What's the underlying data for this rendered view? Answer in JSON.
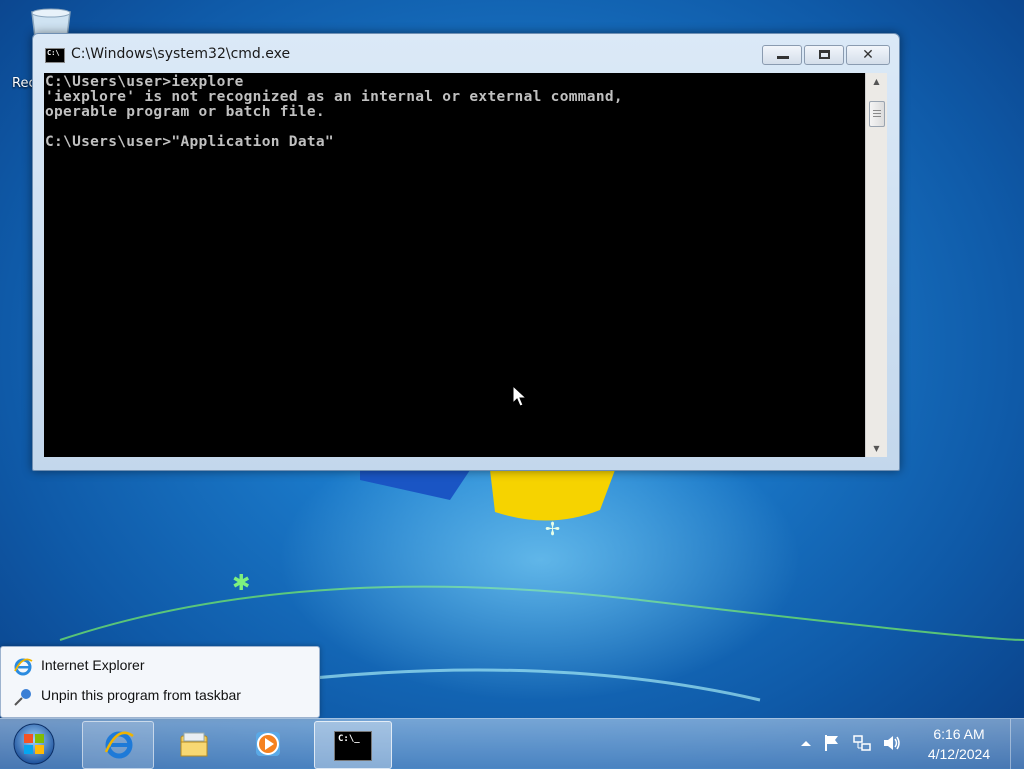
{
  "desktop": {
    "recycle_bin_label": "Recycle Bin"
  },
  "cmd_window": {
    "title": "C:\\Windows\\system32\\cmd.exe",
    "icon_text": "C:\\",
    "console_lines": [
      "C:\\Users\\user>iexplore",
      "'iexplore' is not recognized as an internal or external command,",
      "operable program or batch file.",
      "",
      "C:\\Users\\user>\"Application Data\""
    ]
  },
  "jumplist": {
    "items": [
      {
        "label": "Internet Explorer",
        "icon": "internet-explorer-icon"
      },
      {
        "label": "Unpin this program from taskbar",
        "icon": "unpin-icon"
      }
    ]
  },
  "taskbar": {
    "buttons": [
      {
        "name": "internet-explorer",
        "icon": "internet-explorer-icon"
      },
      {
        "name": "windows-explorer",
        "icon": "folder-icon"
      },
      {
        "name": "media-player",
        "icon": "media-player-icon"
      },
      {
        "name": "command-prompt",
        "icon": "cmd-icon",
        "icon_text": "C:\\_",
        "active": true
      }
    ],
    "clock": {
      "time": "6:16 AM",
      "date": "4/12/2024"
    }
  }
}
